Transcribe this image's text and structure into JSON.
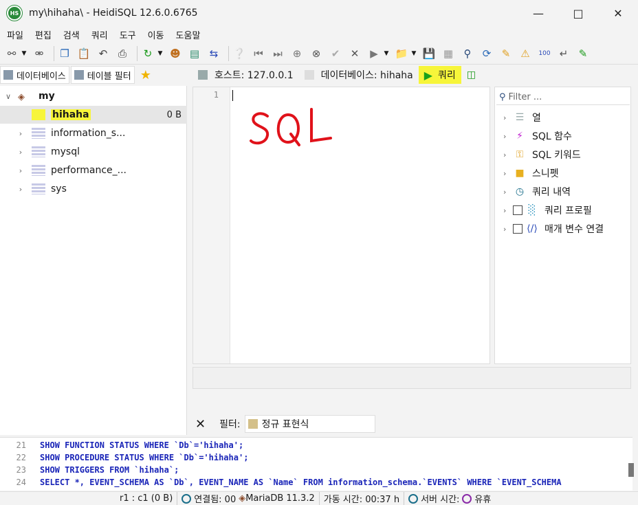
{
  "window": {
    "title": "my\\hihaha\\ - HeidiSQL 12.6.0.6765",
    "icon_text": "HS"
  },
  "menu": [
    "파일",
    "편집",
    "검색",
    "쿼리",
    "도구",
    "이동",
    "도움말"
  ],
  "left_tabs": {
    "database": "데이터베이스",
    "table_filter": "테이블 필터"
  },
  "tree": {
    "root": "my",
    "items": [
      {
        "name": "hihaha",
        "size": "0 B",
        "selected": true
      },
      {
        "name": "information_s...",
        "size": ""
      },
      {
        "name": "mysql",
        "size": ""
      },
      {
        "name": "performance_...",
        "size": ""
      },
      {
        "name": "sys",
        "size": ""
      }
    ]
  },
  "right_tabs": {
    "host": "호스트: 127.0.0.1",
    "database": "데이터베이스: hihaha",
    "query": "쿼리"
  },
  "editor": {
    "line_number": "1",
    "handwritten": "SQL"
  },
  "helpers": {
    "filter_placeholder": "Filter ...",
    "items": [
      "열",
      "SQL 함수",
      "SQL 키워드",
      "스니펫",
      "쿼리 내역",
      "쿼리 프로필",
      "매개 변수 연결"
    ]
  },
  "filter_bar": {
    "label": "필터:",
    "mode": "정규 표현식"
  },
  "sql_log": [
    {
      "no": "21",
      "text": "SHOW FUNCTION STATUS WHERE `Db`='hihaha';"
    },
    {
      "no": "22",
      "text": "SHOW PROCEDURE STATUS WHERE `Db`='hihaha';"
    },
    {
      "no": "23",
      "text": "SHOW TRIGGERS FROM `hihaha`;"
    },
    {
      "no": "24",
      "text": "SELECT *, EVENT_SCHEMA AS `Db`, EVENT_NAME AS `Name` FROM information_schema.`EVENTS` WHERE `EVENT_SCHEMA"
    }
  ],
  "status": {
    "position": "r1 : c1 (0 B)",
    "connected": "연결됨: 00",
    "server": "MariaDB 11.3.2",
    "uptime": "가동 시간: 00:37 h",
    "server_time": "서버 시간:",
    "idle": "유휴"
  }
}
